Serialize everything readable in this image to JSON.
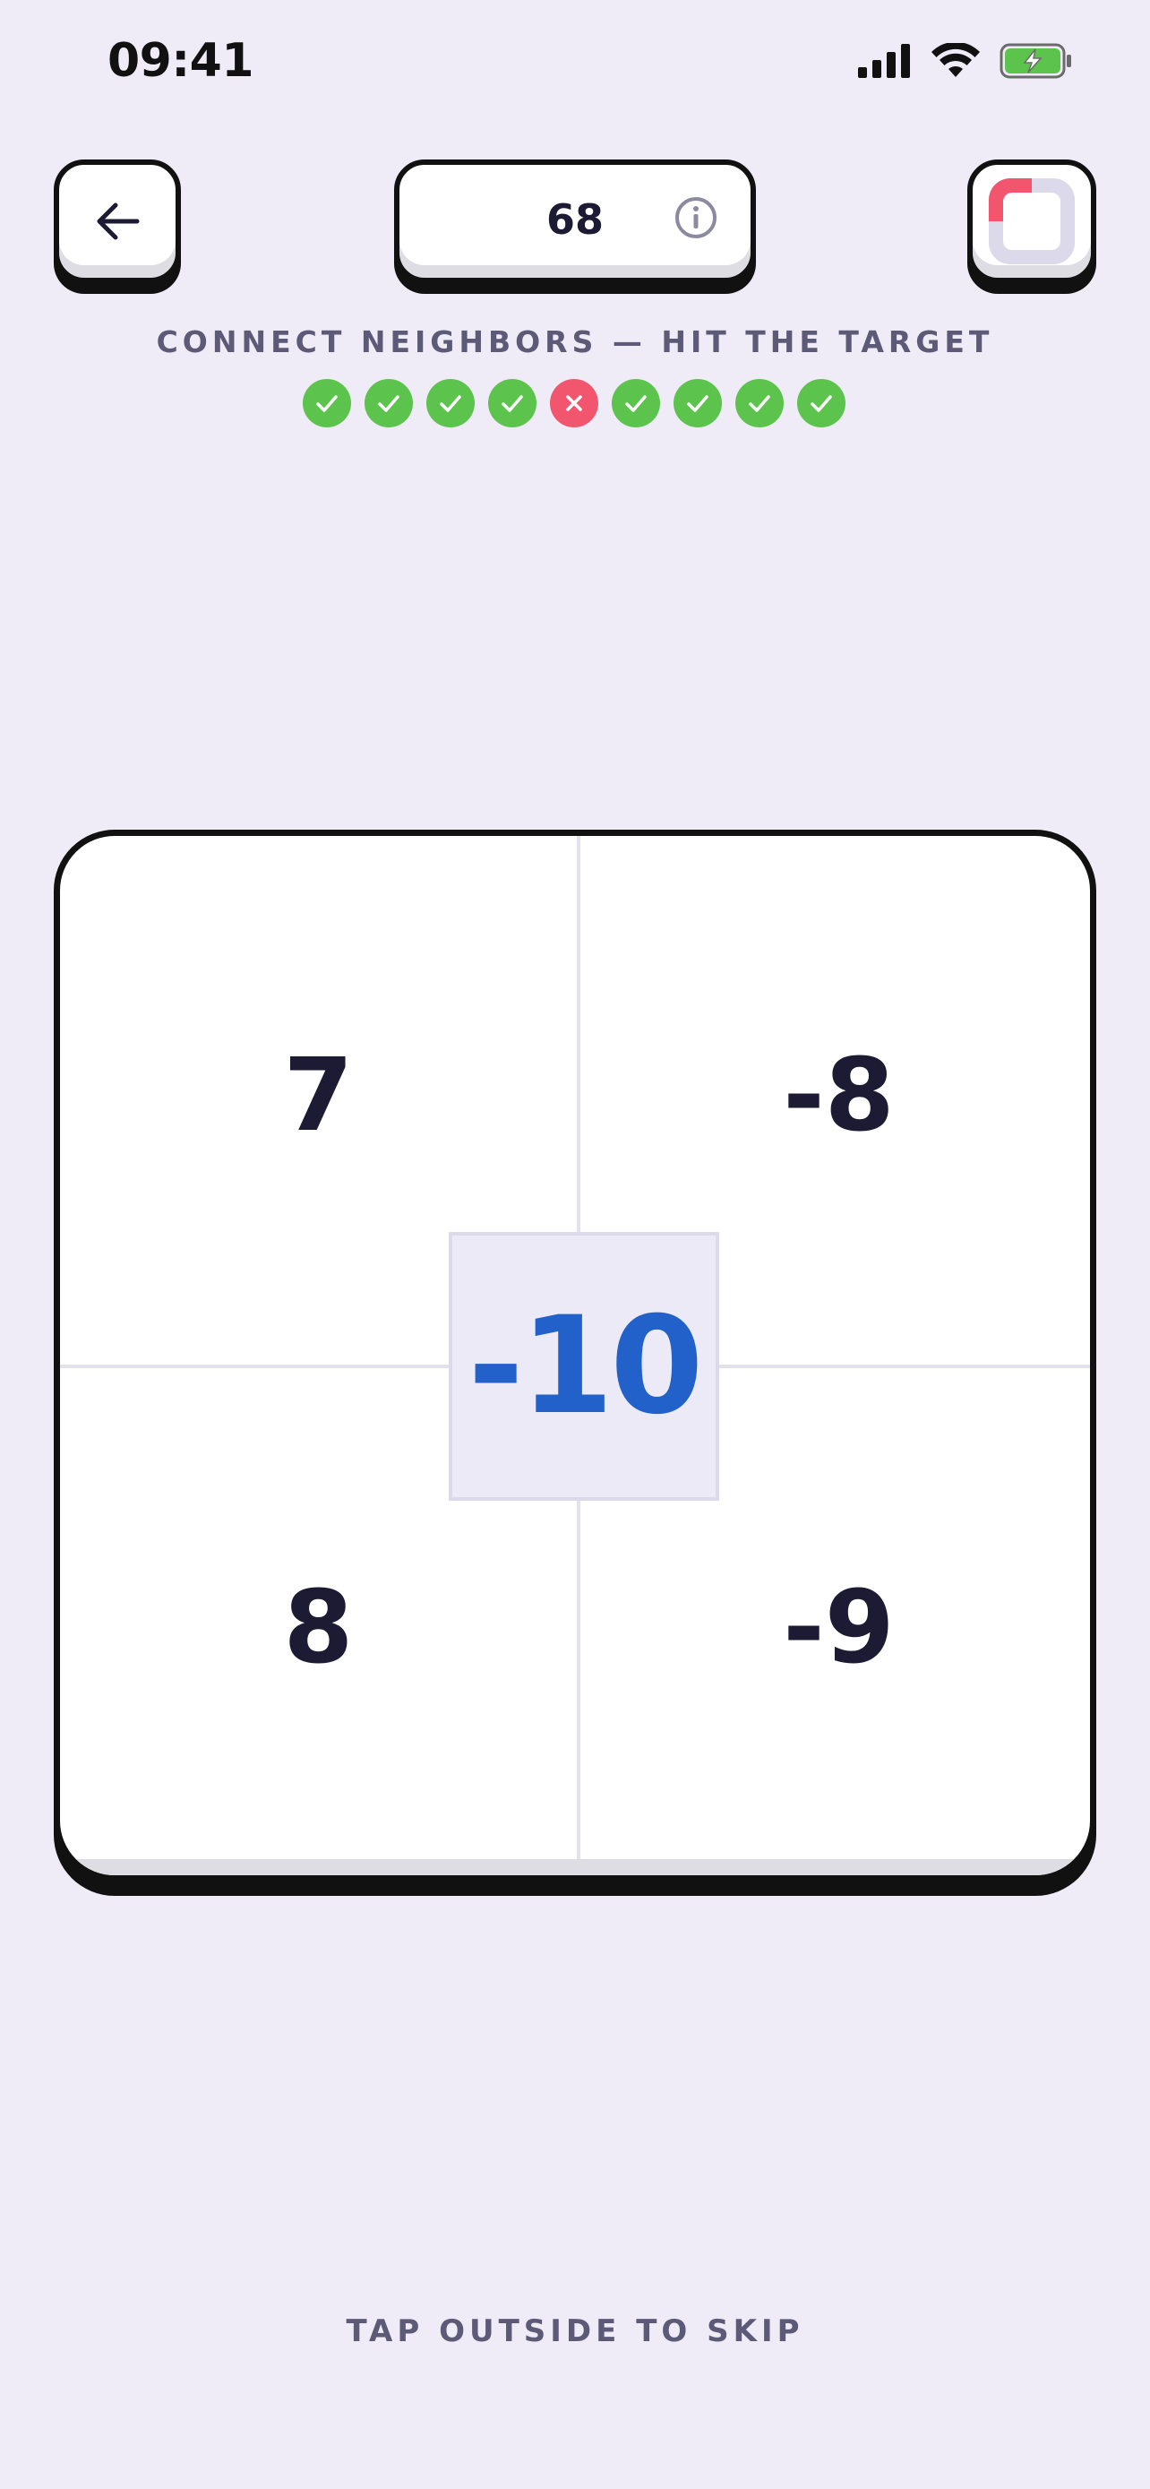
{
  "status_bar": {
    "time": "09:41"
  },
  "header": {
    "score": "68"
  },
  "instruction": "CONNECT NEIGHBORS — HIT THE TARGET",
  "results": [
    "correct",
    "correct",
    "correct",
    "correct",
    "wrong",
    "correct",
    "correct",
    "correct",
    "correct"
  ],
  "board": {
    "cells": {
      "top_left": "7",
      "top_right": "-8",
      "bottom_left": "8",
      "bottom_right": "-9"
    },
    "target": "-10"
  },
  "footer": {
    "skip_hint": "TAP OUTSIDE TO SKIP"
  },
  "colors": {
    "background": "#efecf7",
    "correct": "#5cc44d",
    "wrong": "#f2566e",
    "target": "#2161c9",
    "progress_accent": "#f2566e",
    "progress_track": "#dcdaea"
  }
}
